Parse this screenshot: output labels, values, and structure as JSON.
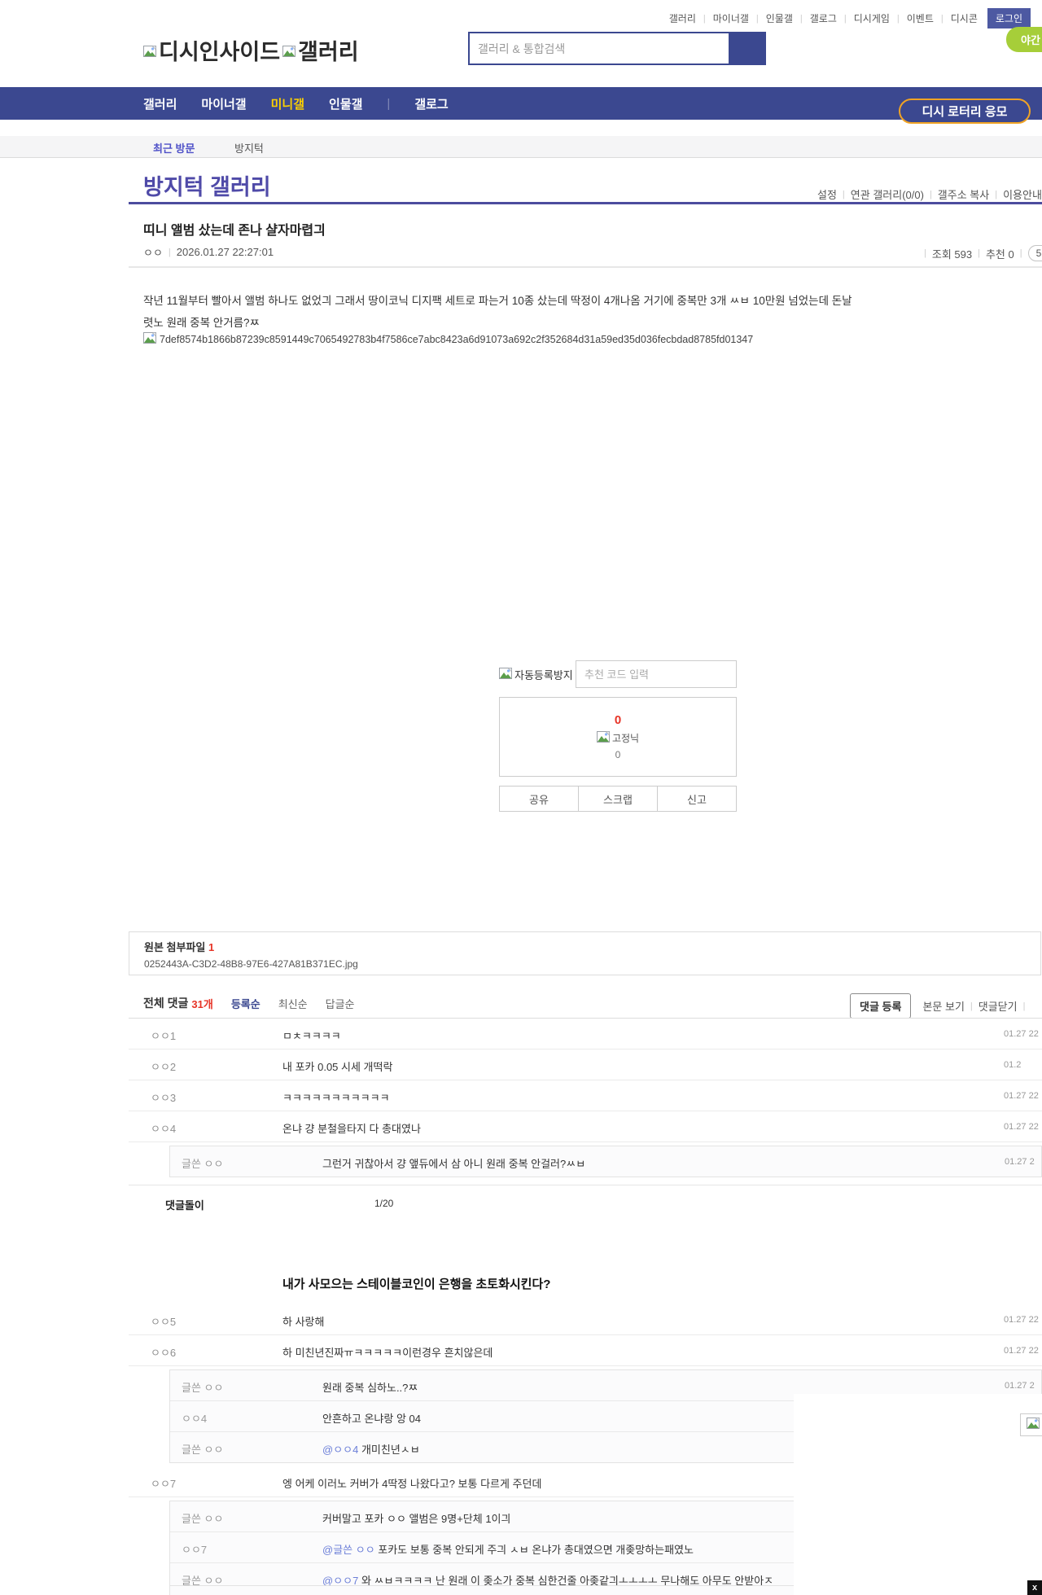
{
  "topbar": {
    "links": [
      "갤러리",
      "마이너갤",
      "인물갤",
      "갤로그",
      "디시게임",
      "이벤트",
      "디시콘"
    ],
    "login_label": "로그인",
    "night_mode_label": "야간 모드"
  },
  "header": {
    "logo_alt_1": "디시인사이드",
    "logo_alt_2": "갤러리",
    "search_placeholder": "갤러리 & 통합검색"
  },
  "nav": {
    "items": [
      "갤러리",
      "마이너갤",
      "미니갤",
      "인물갤",
      "갤로그"
    ],
    "active_item": "미니갤",
    "lottery_label": "디시 로터리 응모"
  },
  "visited": {
    "label": "최근 방문",
    "gallery": "방지턱"
  },
  "gallery_header": {
    "title": "방지턱 갤러리",
    "links": [
      "설정",
      "연관 갤러리(0/0)",
      "갤주소 복사",
      "이용안내"
    ]
  },
  "post": {
    "title": "띠니 앨범 샀는데 존나 샬자마렵긔",
    "author": "ㅇㅇ",
    "date": "2026.01.27 22:27:01",
    "views_label": "조회 593",
    "recommend_label": "추천 0",
    "comment_pill": "5",
    "body_line1": "작년 11월부터 빨아서 앨범 하나도 없었긔 그래서 땅이코닉 디지팩 세트로 파는거 10종 샀는데 딱정이 4개나옴 거기에 중복만 3개 ㅆㅂ 10만원 넘었는데 돈날",
    "body_line2": "렷노 원래 중복 안거름?ㅉ",
    "image_alt": "7def8574b1866b87239c8591449c7065492783b4f7586ce7abc8423a6d91073a692c2f352684d31a59ed35d036fecbdad8785fd01347"
  },
  "vote": {
    "captcha_alt": "자동등록방지",
    "code_placeholder": "추천 코드 입력",
    "up_count": "0",
    "fixed_nick_alt": "고정닉",
    "down_count": "0",
    "buttons": [
      "공유",
      "스크랩",
      "신고"
    ]
  },
  "attachment": {
    "label": "원본 첨부파일",
    "count": "1",
    "filename": "0252443A-C3D2-48B8-97E6-427A81B371EC.jpg"
  },
  "comments": {
    "total_label": "전체 댓글",
    "total_count": "31개",
    "sorts": [
      "등록순",
      "최신순",
      "답글순"
    ],
    "active_sort": "등록순",
    "register_label": "댓글 등록",
    "view_post_label": "본문 보기",
    "close_label": "댓글닫기",
    "pager": {
      "label": "댓글돌이",
      "page": "1/20"
    },
    "ad_text": "내가 사모으는 스테이블코인이 은행을 초토화시킨다?",
    "list1": [
      {
        "type": "main",
        "author": "ㅇㅇ1",
        "text": "ㅁㅊㅋㅋㅋㅋ",
        "time": "01.27 22"
      },
      {
        "type": "main",
        "author": "ㅇㅇ2",
        "text": "내 포카 0.05 시세 개떡락",
        "time": "01.2"
      },
      {
        "type": "main",
        "author": "ㅇㅇ3",
        "text": "ㅋㅋㅋㅋㅋㅋㅋㅋㅋㅋㅋ",
        "time": "01.27 22"
      },
      {
        "type": "main",
        "author": "ㅇㅇ4",
        "text": "온냐 걍 분철을타지 다 총대였나",
        "time": "01.27 22"
      },
      {
        "type": "reply",
        "author": "글쓴 ㅇㅇ",
        "text": "그런거 귀찮아서 걍 앺듀에서 삼 아니 원래 중복 안걸러?ㅆㅂ",
        "time": "01.27 2"
      }
    ],
    "list2": [
      {
        "type": "main",
        "author": "ㅇㅇ5",
        "text": "하 사랑해",
        "time": "01.27 22"
      },
      {
        "type": "main",
        "author": "ㅇㅇ6",
        "text": "하 미친년진짜ㅠㅋㅋㅋㅋㅋ이런경우 흔치않은데",
        "time": "01.27 22"
      },
      {
        "type": "reply",
        "author": "글쓴 ㅇㅇ",
        "text": "원래 중복 심하노..?ㅉ",
        "time": "01.27 2"
      },
      {
        "type": "reply",
        "author": "ㅇㅇ4",
        "text": "안흔하고 온냐랑 앙 04"
      },
      {
        "type": "reply",
        "author": "글쓴 ㅇㅇ",
        "mention": "@ㅇㅇ4",
        "text": "개미친년ㅅㅂ"
      },
      {
        "type": "main",
        "author": "ㅇㅇ7",
        "text": "엥 어케 이러노 커버가 4딱정 나왔다고? 보통 다르게 주던데"
      },
      {
        "type": "reply",
        "author": "글쓴 ㅇㅇ",
        "text": "커버말고 포카 ㅇㅇ 앨범은 9명+단체 1이긔"
      },
      {
        "type": "reply",
        "author": "ㅇㅇ7",
        "mention": "@글쓴 ㅇㅇ",
        "text": "포카도 보통 중복 안되게 주긔 ㅅㅂ 온냐가 총대였으면 개좆망하는패였노"
      },
      {
        "type": "reply",
        "author": "글쓴 ㅇㅇ",
        "mention": "@ㅇㅇ7",
        "text": "와 ㅆㅂㅋㅋㅋㅋ 난 원래 이 좆소가 중복 심한건줄 아좆같긔ㅗㅗㅗㅗ 무나해도 아무도 안받아ㅈ"
      }
    ]
  },
  "overlay": {
    "close_label": "x"
  },
  "colors": {
    "nav_blue": "#3b4890",
    "active_tab_yellow": "#fcd000",
    "lottery_orange": "#f0a324",
    "night_mode_green": "#a6ce39",
    "title_purple": "#4f4aa8",
    "accent_red": "#e73427",
    "mention_blue": "#6c7fd8",
    "login_button_blue": "#4d59a2"
  }
}
